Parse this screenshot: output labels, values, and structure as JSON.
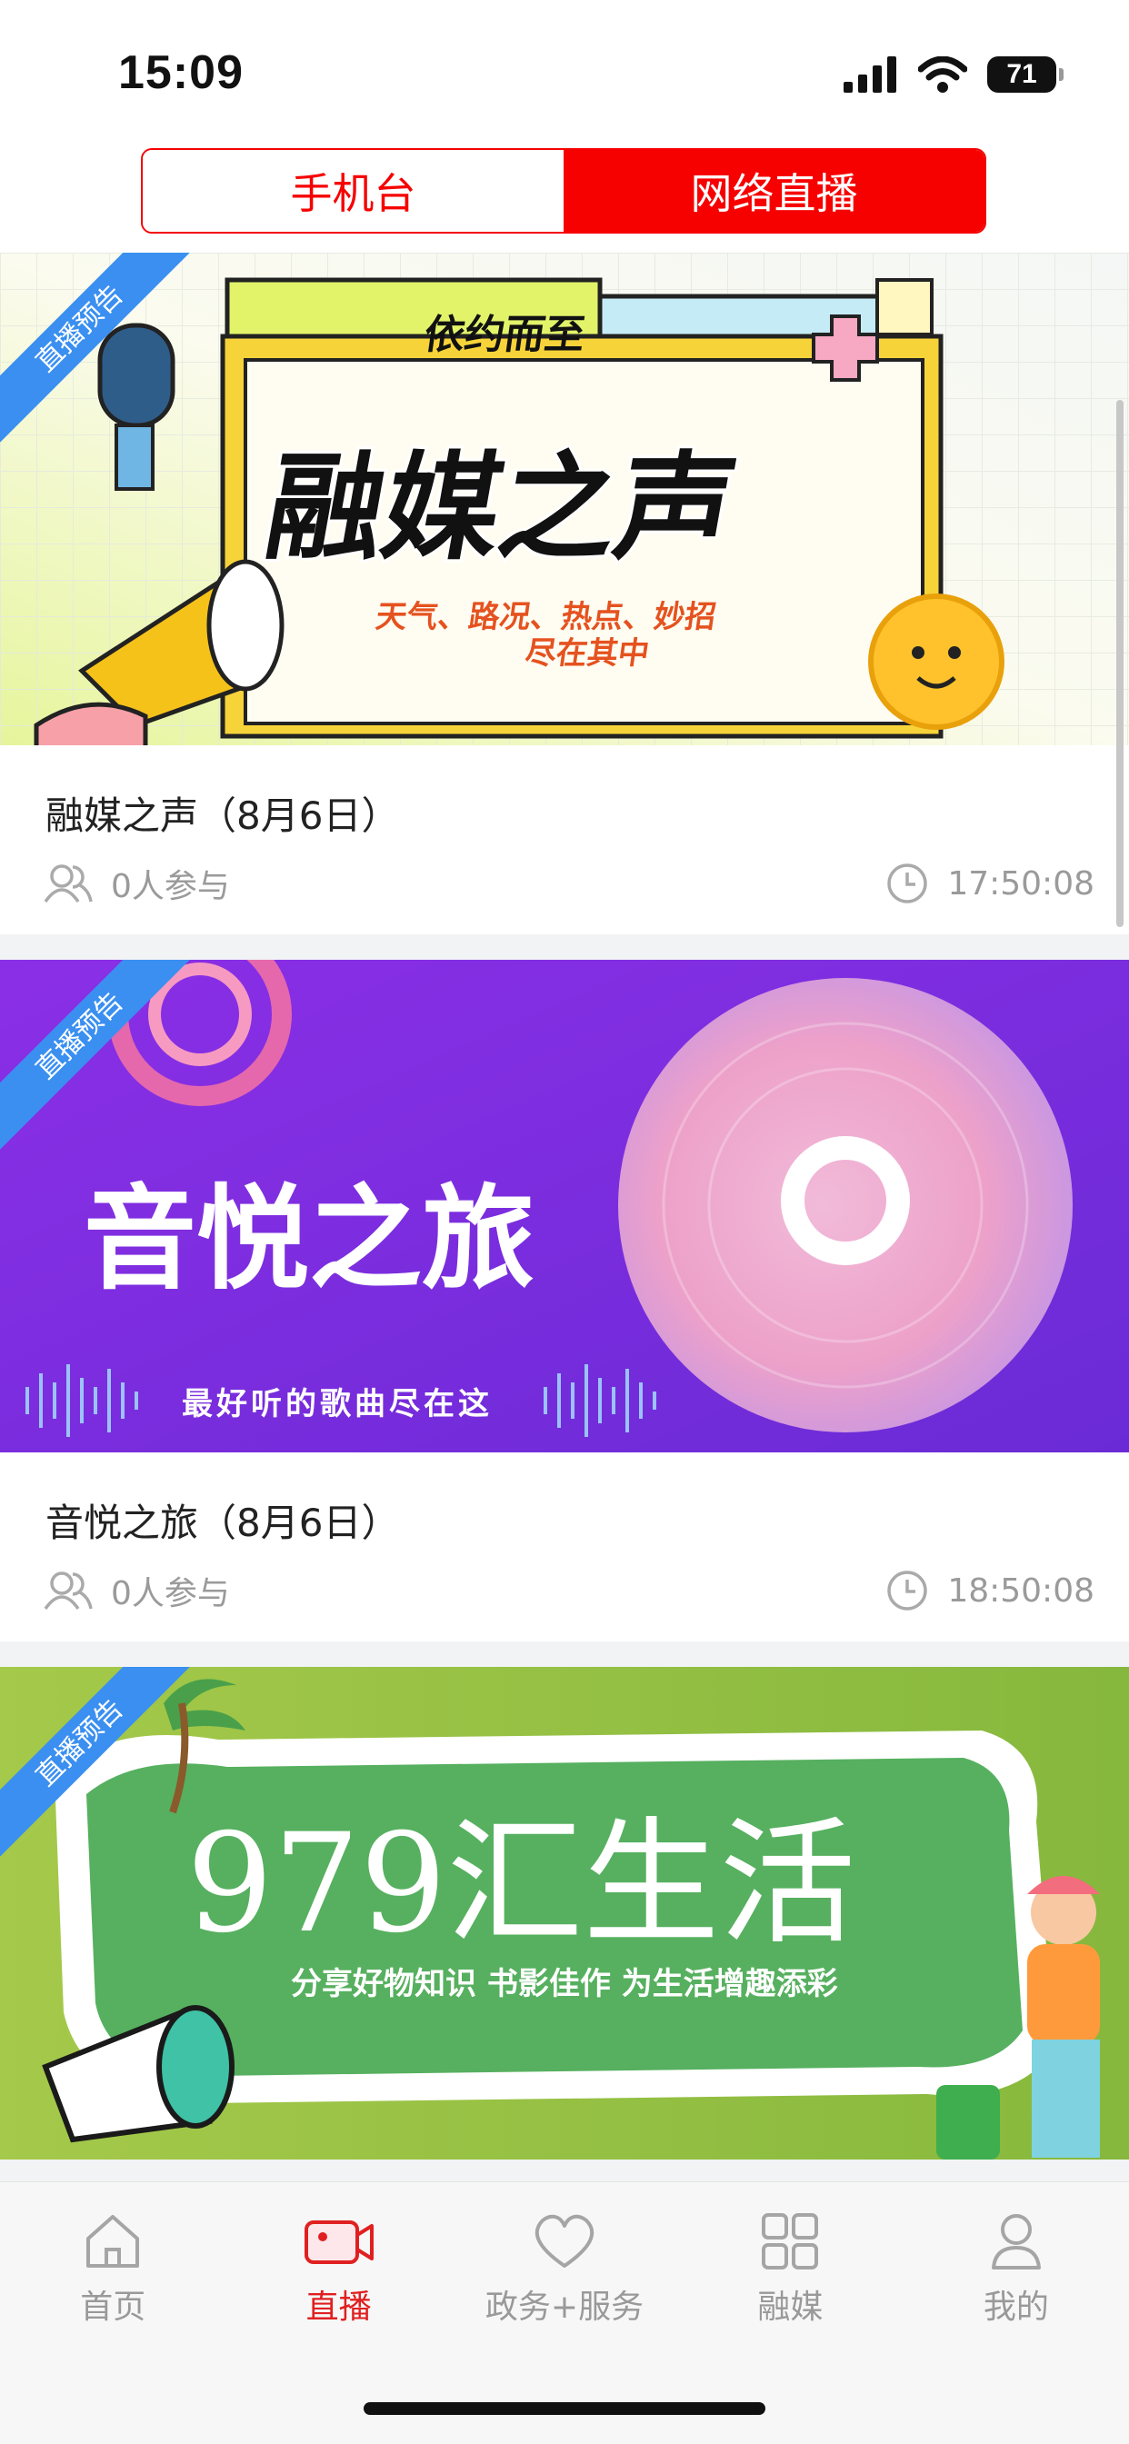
{
  "status_bar": {
    "time": "15:09",
    "battery": "71"
  },
  "header": {
    "tabs": [
      {
        "label": "手机台",
        "active": false
      },
      {
        "label": "网络直播",
        "active": true
      }
    ]
  },
  "live_items": [
    {
      "badge": "直播预告",
      "banner": {
        "headline": "融媒之声",
        "tagline": "依约而至",
        "subtitle_line1": "天气、路况、热点、妙招",
        "subtitle_line2": "尽在其中"
      },
      "title": "融媒之声（8月6日）",
      "participants": "0人参与",
      "time": "17:50:08"
    },
    {
      "badge": "直播预告",
      "banner": {
        "headline": "音悦之旅",
        "subtitle": "最好听的歌曲尽在这"
      },
      "title": "音悦之旅（8月6日）",
      "participants": "0人参与",
      "time": "18:50:08"
    },
    {
      "badge": "直播预告",
      "banner": {
        "headline": "979汇生活",
        "subtitle": "分享好物知识 书影佳作 为生活增趣添彩"
      }
    }
  ],
  "tab_bar": [
    {
      "label": "首页",
      "icon": "home-icon"
    },
    {
      "label": "直播",
      "icon": "video-camera-icon",
      "active": true
    },
    {
      "label": "政务+服务",
      "icon": "heart-icon"
    },
    {
      "label": "融媒",
      "icon": "grid-icon"
    },
    {
      "label": "我的",
      "icon": "user-icon"
    }
  ],
  "colors": {
    "brand_red": "#f60000",
    "badge_blue": "#3a8ff0"
  }
}
